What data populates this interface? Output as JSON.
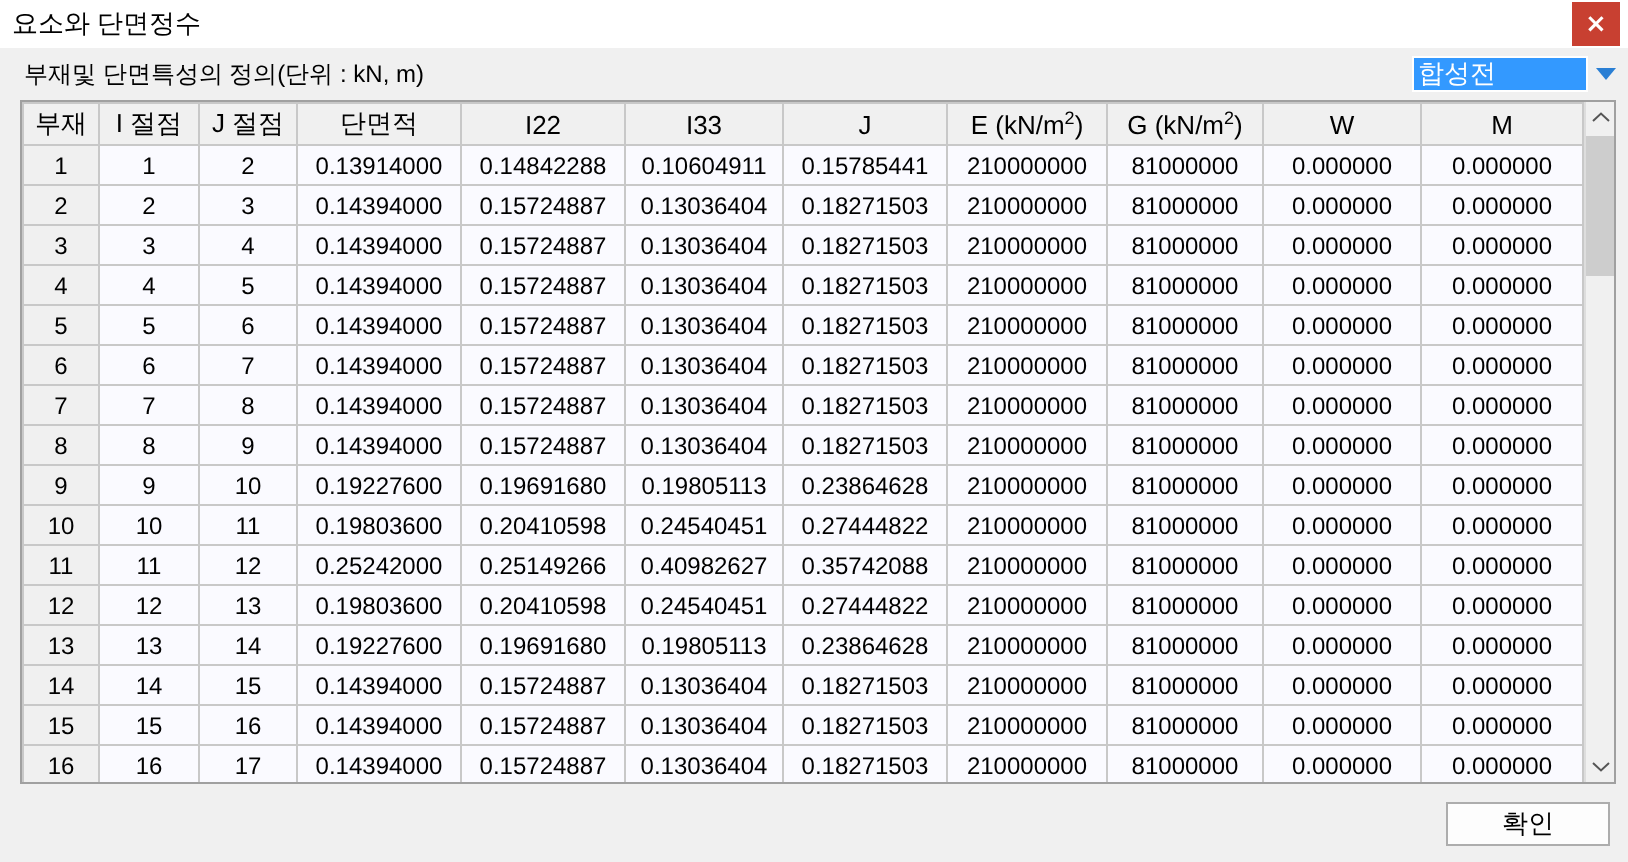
{
  "window": {
    "title": "요소와 단면정수",
    "close": "×"
  },
  "definition": {
    "label": "부재및 단면특성의 정의(단위 : kN, m)",
    "dropdown": {
      "value": "합성전"
    }
  },
  "table": {
    "columns": [
      "부재",
      "I 절점",
      "J 절점",
      "단면적",
      "I22",
      "I33",
      "J",
      "E (kN/m$^{2}$)",
      "G (kN/m$^{2}$)",
      "W",
      "M"
    ],
    "rows": [
      [
        "1",
        "1",
        "2",
        "0.13914000",
        "0.14842288",
        "0.10604911",
        "0.15785441",
        "210000000",
        "81000000",
        "0.000000",
        "0.000000"
      ],
      [
        "2",
        "2",
        "3",
        "0.14394000",
        "0.15724887",
        "0.13036404",
        "0.18271503",
        "210000000",
        "81000000",
        "0.000000",
        "0.000000"
      ],
      [
        "3",
        "3",
        "4",
        "0.14394000",
        "0.15724887",
        "0.13036404",
        "0.18271503",
        "210000000",
        "81000000",
        "0.000000",
        "0.000000"
      ],
      [
        "4",
        "4",
        "5",
        "0.14394000",
        "0.15724887",
        "0.13036404",
        "0.18271503",
        "210000000",
        "81000000",
        "0.000000",
        "0.000000"
      ],
      [
        "5",
        "5",
        "6",
        "0.14394000",
        "0.15724887",
        "0.13036404",
        "0.18271503",
        "210000000",
        "81000000",
        "0.000000",
        "0.000000"
      ],
      [
        "6",
        "6",
        "7",
        "0.14394000",
        "0.15724887",
        "0.13036404",
        "0.18271503",
        "210000000",
        "81000000",
        "0.000000",
        "0.000000"
      ],
      [
        "7",
        "7",
        "8",
        "0.14394000",
        "0.15724887",
        "0.13036404",
        "0.18271503",
        "210000000",
        "81000000",
        "0.000000",
        "0.000000"
      ],
      [
        "8",
        "8",
        "9",
        "0.14394000",
        "0.15724887",
        "0.13036404",
        "0.18271503",
        "210000000",
        "81000000",
        "0.000000",
        "0.000000"
      ],
      [
        "9",
        "9",
        "10",
        "0.19227600",
        "0.19691680",
        "0.19805113",
        "0.23864628",
        "210000000",
        "81000000",
        "0.000000",
        "0.000000"
      ],
      [
        "10",
        "10",
        "11",
        "0.19803600",
        "0.20410598",
        "0.24540451",
        "0.27444822",
        "210000000",
        "81000000",
        "0.000000",
        "0.000000"
      ],
      [
        "11",
        "11",
        "12",
        "0.25242000",
        "0.25149266",
        "0.40982627",
        "0.35742088",
        "210000000",
        "81000000",
        "0.000000",
        "0.000000"
      ],
      [
        "12",
        "12",
        "13",
        "0.19803600",
        "0.20410598",
        "0.24540451",
        "0.27444822",
        "210000000",
        "81000000",
        "0.000000",
        "0.000000"
      ],
      [
        "13",
        "13",
        "14",
        "0.19227600",
        "0.19691680",
        "0.19805113",
        "0.23864628",
        "210000000",
        "81000000",
        "0.000000",
        "0.000000"
      ],
      [
        "14",
        "14",
        "15",
        "0.14394000",
        "0.15724887",
        "0.13036404",
        "0.18271503",
        "210000000",
        "81000000",
        "0.000000",
        "0.000000"
      ],
      [
        "15",
        "15",
        "16",
        "0.14394000",
        "0.15724887",
        "0.13036404",
        "0.18271503",
        "210000000",
        "81000000",
        "0.000000",
        "0.000000"
      ],
      [
        "16",
        "16",
        "17",
        "0.14394000",
        "0.15724887",
        "0.13036404",
        "0.18271503",
        "210000000",
        "81000000",
        "0.000000",
        "0.000000"
      ]
    ]
  },
  "buttons": [
    "확인"
  ]
}
